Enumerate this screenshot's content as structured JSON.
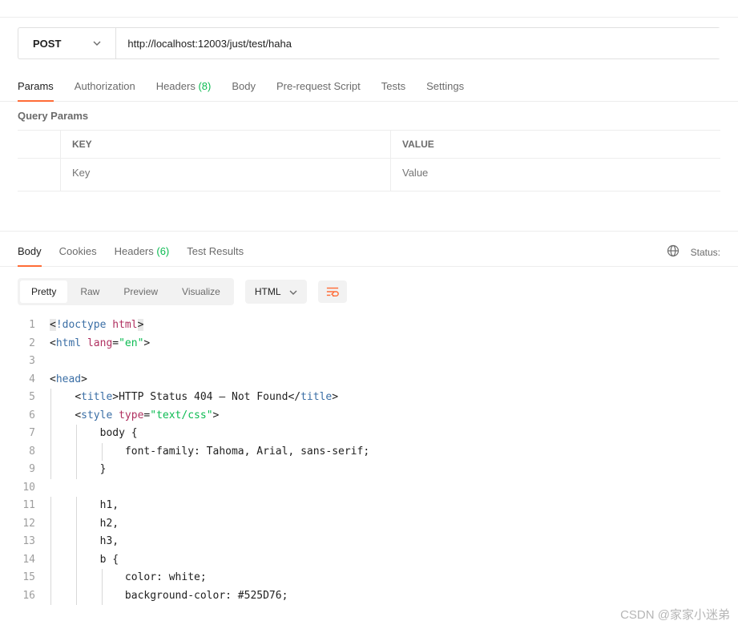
{
  "request": {
    "method": "POST",
    "url": "http://localhost:12003/just/test/haha"
  },
  "tabs": {
    "params": "Params",
    "authorization": "Authorization",
    "headers": "Headers",
    "headers_count": "(8)",
    "body": "Body",
    "prerequest": "Pre-request Script",
    "tests": "Tests",
    "settings": "Settings"
  },
  "query_params": {
    "title": "Query Params",
    "key_header": "KEY",
    "value_header": "VALUE",
    "key_placeholder": "Key",
    "value_placeholder": "Value"
  },
  "response": {
    "tabs": {
      "body": "Body",
      "cookies": "Cookies",
      "headers": "Headers",
      "headers_count": "(6)",
      "test_results": "Test Results"
    },
    "status_label": "Status:",
    "view_tabs": {
      "pretty": "Pretty",
      "raw": "Raw",
      "preview": "Preview",
      "visualize": "Visualize"
    },
    "format": "HTML"
  },
  "code": {
    "lines": [
      {
        "n": 1,
        "indent": 0,
        "segs": [
          {
            "t": "<",
            "c": "tok-punct hl"
          },
          {
            "t": "!doctype ",
            "c": "tok-doctype"
          },
          {
            "t": "html",
            "c": "tok-keyword"
          },
          {
            "t": ">",
            "c": "tok-punct hl"
          }
        ]
      },
      {
        "n": 2,
        "indent": 0,
        "segs": [
          {
            "t": "<",
            "c": "tok-punct"
          },
          {
            "t": "html ",
            "c": "tok-tag"
          },
          {
            "t": "lang",
            "c": "tok-attr"
          },
          {
            "t": "=",
            "c": "tok-punct"
          },
          {
            "t": "\"en\"",
            "c": "tok-string"
          },
          {
            "t": ">",
            "c": "tok-punct"
          }
        ]
      },
      {
        "n": 3,
        "indent": 0,
        "segs": []
      },
      {
        "n": 4,
        "indent": 0,
        "segs": [
          {
            "t": "<",
            "c": "tok-punct"
          },
          {
            "t": "head",
            "c": "tok-tag"
          },
          {
            "t": ">",
            "c": "tok-punct"
          }
        ]
      },
      {
        "n": 5,
        "indent": 1,
        "segs": [
          {
            "t": "<",
            "c": "tok-punct"
          },
          {
            "t": "title",
            "c": "tok-tag"
          },
          {
            "t": ">",
            "c": "tok-punct"
          },
          {
            "t": "HTTP Status 404 – Not Found",
            "c": "tok-text"
          },
          {
            "t": "</",
            "c": "tok-punct"
          },
          {
            "t": "title",
            "c": "tok-tag"
          },
          {
            "t": ">",
            "c": "tok-punct"
          }
        ]
      },
      {
        "n": 6,
        "indent": 1,
        "segs": [
          {
            "t": "<",
            "c": "tok-punct"
          },
          {
            "t": "style ",
            "c": "tok-tag"
          },
          {
            "t": "type",
            "c": "tok-attr"
          },
          {
            "t": "=",
            "c": "tok-punct"
          },
          {
            "t": "\"text/css\"",
            "c": "tok-string"
          },
          {
            "t": ">",
            "c": "tok-punct"
          }
        ]
      },
      {
        "n": 7,
        "indent": 2,
        "segs": [
          {
            "t": "body {",
            "c": "tok-text"
          }
        ]
      },
      {
        "n": 8,
        "indent": 3,
        "segs": [
          {
            "t": "font-family: Tahoma, Arial, sans-serif;",
            "c": "tok-text"
          }
        ]
      },
      {
        "n": 9,
        "indent": 2,
        "segs": [
          {
            "t": "}",
            "c": "tok-text"
          }
        ]
      },
      {
        "n": 10,
        "indent": 0,
        "segs": []
      },
      {
        "n": 11,
        "indent": 2,
        "segs": [
          {
            "t": "h1,",
            "c": "tok-text"
          }
        ]
      },
      {
        "n": 12,
        "indent": 2,
        "segs": [
          {
            "t": "h2,",
            "c": "tok-text"
          }
        ]
      },
      {
        "n": 13,
        "indent": 2,
        "segs": [
          {
            "t": "h3,",
            "c": "tok-text"
          }
        ]
      },
      {
        "n": 14,
        "indent": 2,
        "segs": [
          {
            "t": "b {",
            "c": "tok-text"
          }
        ]
      },
      {
        "n": 15,
        "indent": 3,
        "segs": [
          {
            "t": "color: white;",
            "c": "tok-text"
          }
        ]
      },
      {
        "n": 16,
        "indent": 3,
        "segs": [
          {
            "t": "background-color: #525D76;",
            "c": "tok-text"
          }
        ]
      }
    ]
  },
  "watermark": "CSDN @家家小迷弟"
}
